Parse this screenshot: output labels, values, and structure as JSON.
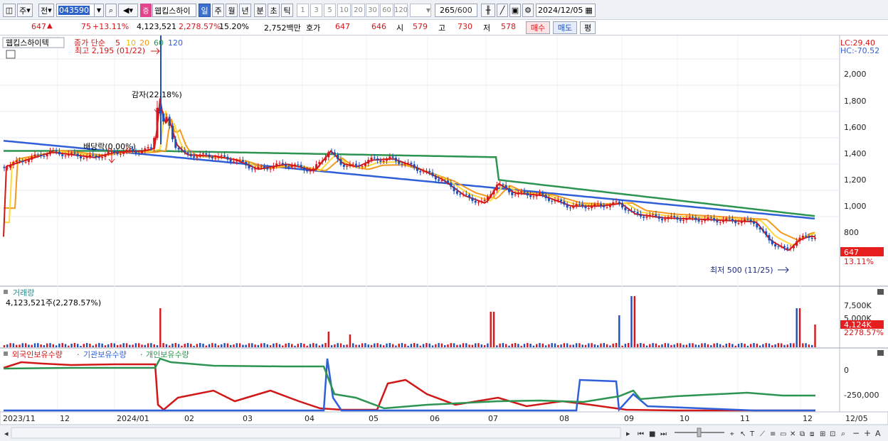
{
  "toolbar": {
    "code": "043590",
    "name": "웹킵스하이",
    "code_opts": "주",
    "type": "전",
    "period_tabs": [
      "일",
      "주",
      "월",
      "년",
      "분",
      "초",
      "틱"
    ],
    "periods": [
      "1",
      "3",
      "5",
      "10",
      "20",
      "30",
      "60",
      "120"
    ],
    "count": "265",
    "count_total": "/600",
    "date": "2024/12/05"
  },
  "quote": {
    "price": "647",
    "change": "75",
    "rate": "+13.11%",
    "volume": "4,123,521",
    "vol_rate": "2,278.57%",
    "turnover": "15.20%",
    "amount": "2,752백만",
    "hoga_label": "호가",
    "ask": "647",
    "bid": "646",
    "open_label": "시",
    "open": "579",
    "high_label": "고",
    "high": "730",
    "low_label": "저",
    "low": "578",
    "buy": "매수",
    "sell": "매도",
    "avg": "평"
  },
  "main_chart": {
    "stock": "웹킵스하이텍",
    "ma_title": "종가 단순",
    "ma_periods": [
      "5",
      "10",
      "20",
      "60",
      "120"
    ],
    "ma_colors": [
      "#d01818",
      "#ffd83a",
      "#f39a1e",
      "#2e9452",
      "#2f5fd9"
    ],
    "lc": "LC:29.40",
    "hc": "HC:-70.52",
    "high_note": "최고 2,195 (01/22)",
    "low_note": "최저 500 (11/25)",
    "dividend_note": "배당락(0.00%)",
    "reduction_note": "감자(22.18%)",
    "y_ticks": [
      "2,000",
      "1,800",
      "1,600",
      "1,400",
      "1,200",
      "1,000",
      "800"
    ],
    "cur_label": "647",
    "cur_rate": "13.11%"
  },
  "volume_chart": {
    "title": "거래량",
    "value": "4,123,521주(2,278.57%)",
    "y_ticks": [
      "7,500K",
      "5,000K"
    ],
    "cur_label": "4,124K",
    "cur_rate": "2278.57%"
  },
  "holdings_chart": {
    "legend": [
      "외국인보유수량",
      "기관보유수량",
      "개인보유수량"
    ],
    "colors": [
      "#d01818",
      "#2f5fd9",
      "#2e9452"
    ],
    "y_ticks": [
      "0",
      "-250,000"
    ]
  },
  "x_axis": [
    "2023/11",
    "12",
    "2024/01",
    "02",
    "03",
    "04",
    "05",
    "06",
    "07",
    "08",
    "09",
    "10",
    "11",
    "12",
    "12/05"
  ],
  "chart_data": {
    "type": "candlestick",
    "x_labels": [
      "2023/11",
      "12",
      "2024/01",
      "02",
      "03",
      "04",
      "05",
      "06",
      "07",
      "08",
      "09",
      "10",
      "11",
      "12"
    ],
    "y_range": [
      500,
      2200
    ],
    "high": 2195,
    "high_date": "01/22",
    "low": 500,
    "low_date": "11/25",
    "last_close": 647,
    "last_volume": 4123521
  }
}
